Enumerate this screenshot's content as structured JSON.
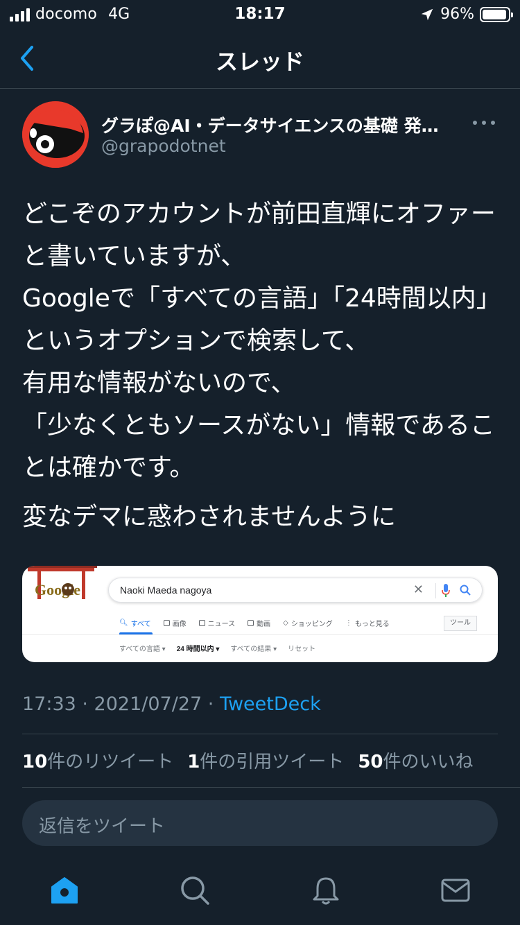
{
  "status_bar": {
    "carrier": "docomo",
    "network": "4G",
    "time": "18:17",
    "battery_percent": "96%",
    "battery_level": 0.96
  },
  "nav": {
    "title": "スレッド",
    "back_icon": "chevron-left-icon"
  },
  "tweet": {
    "author_name": "グラぽ@AI・データサイエンスの基礎 発…",
    "author_handle": "@grapodotnet",
    "text": "どこぞのアカウントが前田直輝にオファーと書いていますが、\nGoogleで「すべての言語」「24時間以内」というオプションで検索して、\n有用な情報がないので、\n「少なくともソースがない」情報であることは確かです。",
    "text_2": "変なデマに惑わされませんように",
    "timestamp": "17:33 · 2021/07/27 · ",
    "source": "TweetDeck",
    "retweets_count": "10",
    "retweets_label": "件のリツイート",
    "quotes_count": "1",
    "quotes_label": "件の引用ツイート",
    "likes_count": "50",
    "likes_label": "件のいいね"
  },
  "embed": {
    "logo_text": "Google",
    "query": "Naoki Maeda nagoya",
    "tabs": [
      "すべて",
      "画像",
      "ニュース",
      "動画",
      "ショッピング",
      "もっと見る"
    ],
    "tools_label": "ツール",
    "filters": [
      "すべての言語 ▾",
      "24 時間以内 ▾",
      "すべての結果 ▾",
      "リセット"
    ]
  },
  "reply": {
    "placeholder": "返信をツイート"
  },
  "tabbar": {
    "items": [
      "home-icon",
      "search-icon",
      "notifications-bell-icon",
      "messages-mail-icon"
    ],
    "accent": "#1da1f2"
  },
  "colors": {
    "background": "#15202b",
    "secondary_text": "#8899a6",
    "accent": "#1da1f2",
    "border": "#38444d"
  }
}
